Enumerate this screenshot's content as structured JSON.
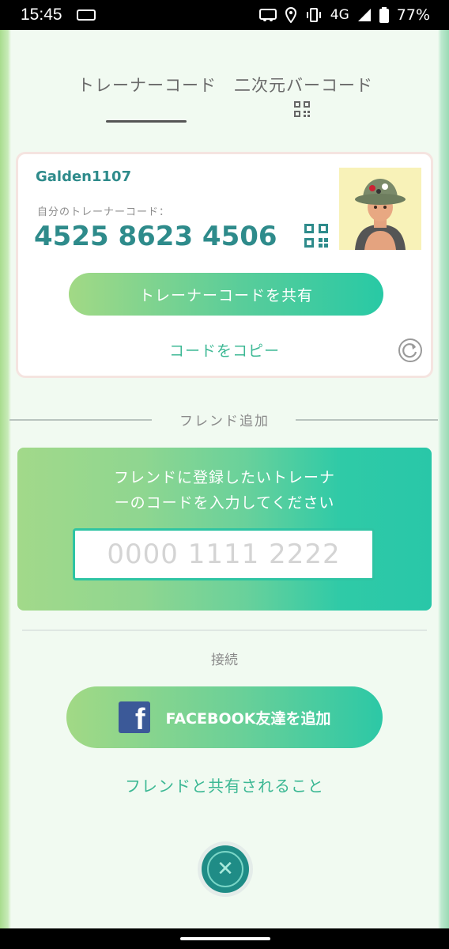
{
  "status_bar": {
    "time": "15:45",
    "network": "4G",
    "battery": "77%"
  },
  "tabs": [
    {
      "label": "トレーナーコード",
      "active": true
    },
    {
      "label": "二次元バーコード",
      "active": false
    }
  ],
  "trainer_card": {
    "name": "Galden1107",
    "code_label": "自分のトレーナーコード：",
    "code": "4525 8623 4506",
    "share_button": "トレーナーコードを共有",
    "copy_link": "コードをコピー"
  },
  "add_friend": {
    "heading": "フレンド追加",
    "instruction_line1": "フレンドに登録したいトレーナ",
    "instruction_line2": "ーのコードを入力してください",
    "input_placeholder": "0000 1111 2222",
    "input_value": ""
  },
  "connect": {
    "heading": "接続",
    "facebook_button": "FACEBOOK友達を追加",
    "shared_link": "フレンドと共有されること"
  },
  "colors": {
    "accent_teal": "#2e8b8b",
    "link_green": "#3cb894",
    "facebook_blue": "#3b5998"
  },
  "icons": [
    "gamepad-icon",
    "location-icon",
    "vibrate-icon",
    "signal-icon",
    "battery-icon",
    "qr-code-icon",
    "refresh-icon",
    "facebook-icon",
    "close-icon"
  ]
}
